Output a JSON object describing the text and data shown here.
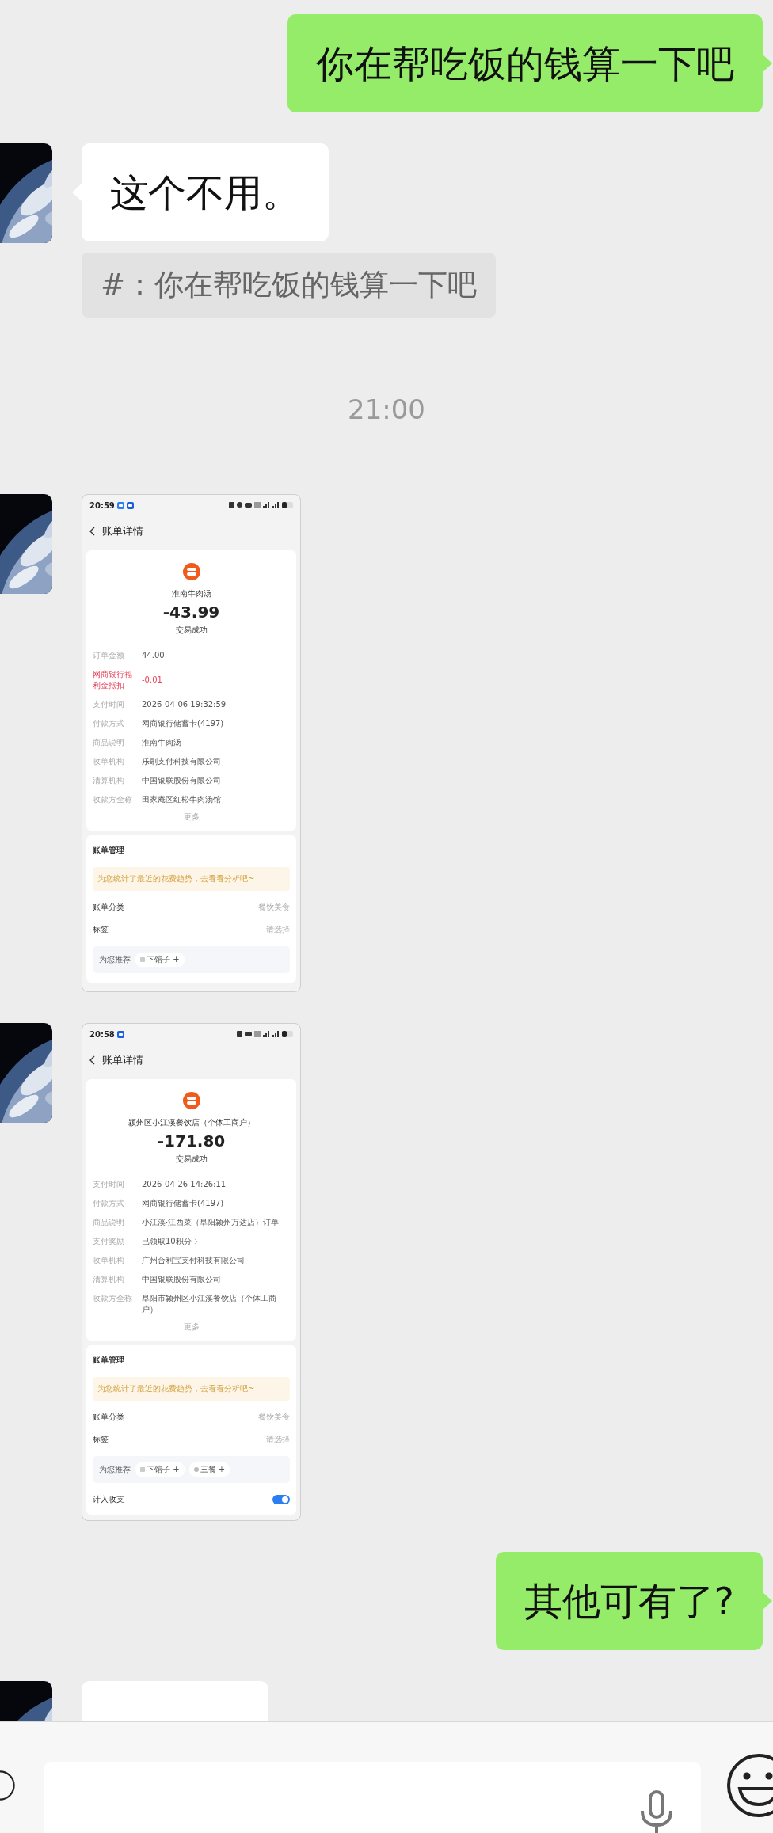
{
  "messages": [
    {
      "kind": "text",
      "outgoing": true,
      "text": "你在帮吃饭的钱算一下吧"
    },
    {
      "kind": "text",
      "outgoing": false,
      "text": "这个不用。",
      "quote": "#：你在帮吃饭的钱算一下吧"
    },
    {
      "kind": "time",
      "text": "21:00"
    },
    {
      "outgoing": false,
      "shot": {
        "time": "20:59",
        "notifications": [
          {
            "kind": "app"
          },
          {
            "kind": "chat"
          }
        ],
        "title": "账单详情",
        "merchant": "淮南牛肉汤",
        "amount": "-43.99",
        "status": "交易成功",
        "rows": [
          {
            "label": "订单金额",
            "value": "44.00",
            "kind": "plain"
          },
          {
            "label": "网商银行福利金抵扣",
            "value": "-0.01",
            "kind": "alert"
          },
          {
            "label": "支付时间",
            "value": "2026-04-06 19:32:59",
            "kind": "plain"
          },
          {
            "label": "付款方式",
            "value": "网商银行储蓄卡(4197)",
            "kind": "plain"
          },
          {
            "label": "商品说明",
            "value": "淮南牛肉汤",
            "kind": "plain"
          },
          {
            "label": "收单机构",
            "value": "乐刷支付科技有限公司",
            "kind": "plain"
          },
          {
            "label": "清算机构",
            "value": "中国银联股份有限公司",
            "kind": "plain"
          },
          {
            "label": "收款方全称",
            "value": "田家庵区红松牛肉汤馆",
            "kind": "plain"
          }
        ],
        "more": "更多",
        "manage_title": "账单管理",
        "banner": "为您统计了最近的花费趋势，去看看分析吧~",
        "settings": [
          {
            "label": "账单分类",
            "value": "餐饮美食"
          },
          {
            "label": "标签",
            "value": "请选择"
          }
        ],
        "recommend_label": "为您推荐",
        "chips": [
          {
            "kind": "restaurant",
            "label": "下馆子",
            "add": "+"
          }
        ]
      }
    },
    {
      "outgoing": false,
      "shot": {
        "time": "20:58",
        "notifications": [
          {
            "kind": "chat"
          }
        ],
        "title": "账单详情",
        "merchant": "颍州区小江溪餐饮店（个体工商户）",
        "amount": "-171.80",
        "status": "交易成功",
        "rows": [
          {
            "label": "支付时间",
            "value": "2026-04-26 14:26:11",
            "kind": "plain"
          },
          {
            "label": "付款方式",
            "value": "网商银行储蓄卡(4197)",
            "kind": "plain"
          },
          {
            "label": "商品说明",
            "value": "小江溪·江西菜（阜阳颍州万达店）订单",
            "kind": "plain"
          },
          {
            "label": "支付奖励",
            "value": "已领取10积分",
            "kind": "link"
          },
          {
            "label": "收单机构",
            "value": "广州合利宝支付科技有限公司",
            "kind": "plain"
          },
          {
            "label": "清算机构",
            "value": "中国银联股份有限公司",
            "kind": "plain"
          },
          {
            "label": "收款方全称",
            "value": "阜阳市颍州区小江溪餐饮店（个体工商户）",
            "kind": "plain"
          }
        ],
        "more": "更多",
        "manage_title": "账单管理",
        "banner": "为您统计了最近的花费趋势，去看看分析吧~",
        "settings": [
          {
            "label": "账单分类",
            "value": "餐饮美食"
          },
          {
            "label": "标签",
            "value": "请选择"
          }
        ],
        "recommend_label": "为您推荐",
        "chips": [
          {
            "kind": "restaurant",
            "label": "下馆子",
            "add": "+"
          },
          {
            "kind": "meal",
            "label": "三餐",
            "add": "+"
          }
        ],
        "count_in": {
          "label": "计入收支",
          "on": true
        }
      }
    },
    {
      "kind": "text",
      "outgoing": true,
      "text": "其他可有了?"
    },
    {
      "kind": "text",
      "outgoing": false
    }
  ]
}
